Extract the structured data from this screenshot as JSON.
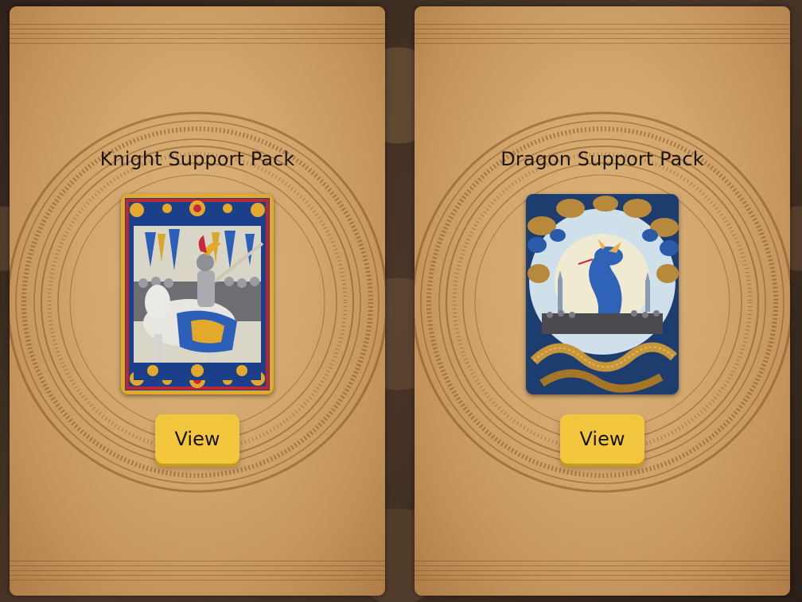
{
  "packs": [
    {
      "title": "Knight Support Pack",
      "button_label": "View",
      "art_icon": "knight-art-icon"
    },
    {
      "title": "Dragon Support Pack",
      "button_label": "View",
      "art_icon": "dragon-art-icon"
    }
  ],
  "colors": {
    "button": "#f2c63d",
    "parchment": "#d2a56b",
    "title_text": "#1d1610"
  }
}
